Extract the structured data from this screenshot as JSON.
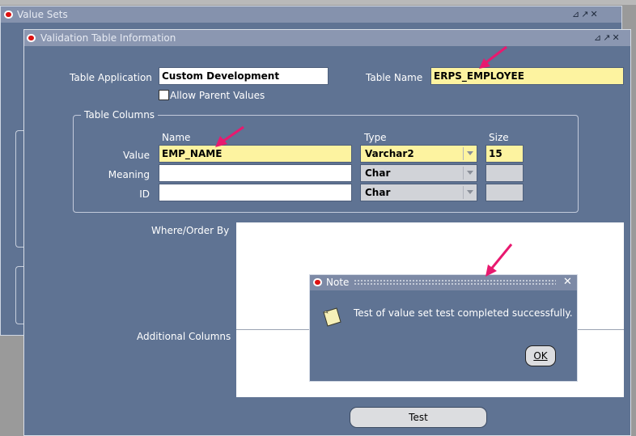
{
  "value_sets_window": {
    "title": "Value Sets"
  },
  "validation_window": {
    "title": "Validation Table Information",
    "table_application_label": "Table Application",
    "table_application_value": "Custom Development",
    "table_name_label": "Table Name",
    "table_name_value": "ERPS_EMPLOYEE",
    "allow_parent_values_label": "Allow Parent Values",
    "table_columns": {
      "group_title": "Table Columns",
      "headers": {
        "name": "Name",
        "type": "Type",
        "size": "Size"
      },
      "rows": [
        {
          "label": "Value",
          "name": "EMP_NAME",
          "type": "Varchar2",
          "size": "15"
        },
        {
          "label": "Meaning",
          "name": "",
          "type": "Char",
          "size": ""
        },
        {
          "label": "ID",
          "name": "",
          "type": "Char",
          "size": ""
        }
      ]
    },
    "where_order_by_label": "Where/Order By",
    "additional_columns_label": "Additional Columns",
    "test_button_label": "Test"
  },
  "note_dialog": {
    "title": "Note",
    "message": "Test of value set test completed successfully.",
    "ok_label": "OK"
  },
  "colors": {
    "window_background": "#5f7393",
    "required_field": "#fdf3a0",
    "annotation_arrow": "#e8196f"
  }
}
